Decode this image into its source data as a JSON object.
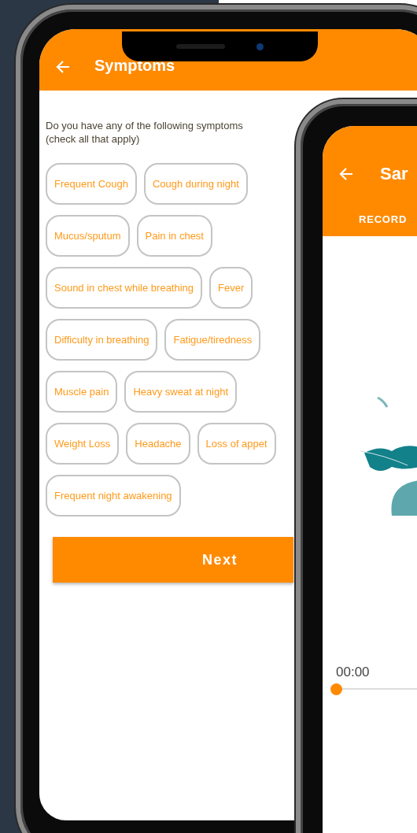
{
  "symptoms_screen": {
    "title": "Symptoms",
    "prompt": "Do you have any of the following symptoms (check all that apply)",
    "symptom_rows": [
      [
        {
          "label": "Frequent Cough",
          "selected": false
        },
        {
          "label": "Cough during night",
          "selected": false
        }
      ],
      [
        {
          "label": "Mucus/sputum",
          "selected": false
        },
        {
          "label": "Pain in chest",
          "selected": false
        }
      ],
      [
        {
          "label": "Sound in chest while breathing",
          "selected": false
        },
        {
          "label": "Fever",
          "selected": false
        }
      ],
      [
        {
          "label": "Difficulty in breathing",
          "selected": false
        },
        {
          "label": "Fatigue/tiredness",
          "selected": false
        }
      ],
      [
        {
          "label": "Muscle pain",
          "selected": false
        },
        {
          "label": "Heavy sweat at night",
          "selected": false
        }
      ],
      [
        {
          "label": "Weight Loss",
          "selected": false
        },
        {
          "label": "Headache",
          "selected": false
        },
        {
          "label": "Loss of appet",
          "selected": false
        }
      ],
      [
        {
          "label": "Frequent night awakening",
          "selected": false
        }
      ]
    ],
    "next_button": "Next"
  },
  "record_screen": {
    "title": "Sar",
    "tab": "RECORD",
    "time": "00:00",
    "progress": {
      "level": 0
    }
  }
}
